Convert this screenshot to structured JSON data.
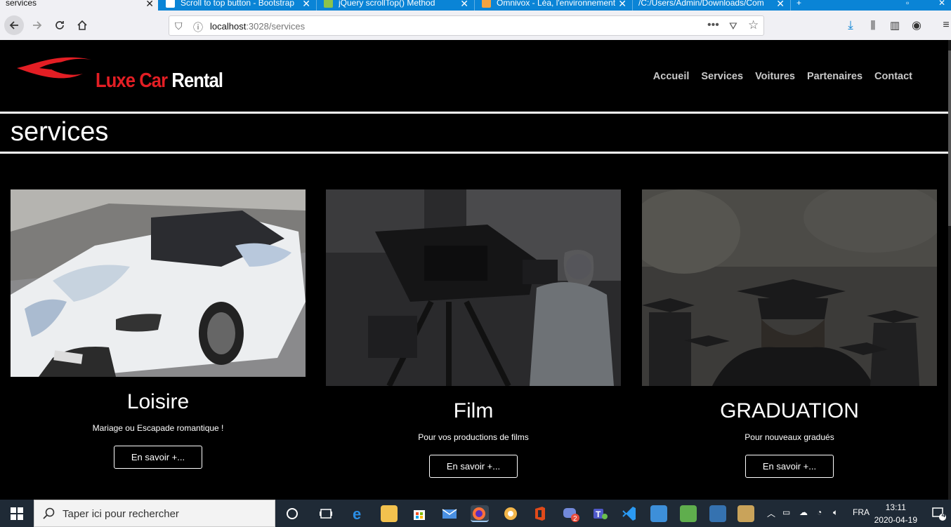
{
  "browser": {
    "tabs": [
      {
        "title": "services",
        "active": true
      },
      {
        "title": "Scroll to top button - Bootstrap",
        "active": false
      },
      {
        "title": "jQuery scrollTop() Method",
        "active": false
      },
      {
        "title": "Omnivox - Léa, l'environnement",
        "active": false
      },
      {
        "title": "/C:/Users/Admin/Downloads/Com",
        "active": false
      }
    ],
    "new_tab": "+",
    "url_host": "localhost",
    "url_rest": ":3028/services"
  },
  "site": {
    "logo_part1": "Luxe Car",
    "logo_part2": "Rental",
    "menu": [
      "Accueil",
      "Services",
      "Voitures",
      "Partenaires",
      "Contact"
    ],
    "page_title": "services",
    "accent": "#e31e24",
    "cards": [
      {
        "title": "Loisire",
        "desc": "Mariage ou Escapade romantique !",
        "button": "En savoir +..."
      },
      {
        "title": "Film",
        "desc": "Pour vos productions de films",
        "button": "En savoir +..."
      },
      {
        "title": "GRADUATION",
        "desc": "Pour nouveaux gradués",
        "button": "En savoir +..."
      }
    ]
  },
  "taskbar": {
    "search_placeholder": "Taper ici pour rechercher",
    "lang": "FRA",
    "time": "13:11",
    "date": "2020-04-19",
    "notif_count": "4",
    "discord_badge": "2"
  }
}
